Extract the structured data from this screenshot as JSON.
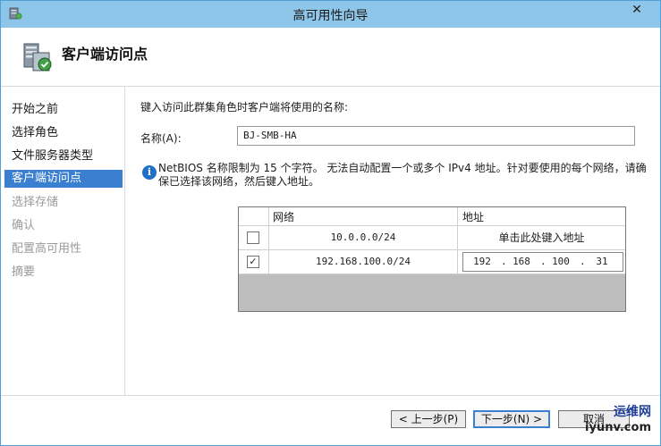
{
  "window": {
    "title": "高可用性向导",
    "close_label": "✕"
  },
  "header": {
    "title": "客户端访问点"
  },
  "sidebar": {
    "items": [
      {
        "label": "开始之前",
        "state": "normal"
      },
      {
        "label": "选择角色",
        "state": "normal"
      },
      {
        "label": "文件服务器类型",
        "state": "normal"
      },
      {
        "label": "客户端访问点",
        "state": "active"
      },
      {
        "label": "选择存储",
        "state": "disabled"
      },
      {
        "label": "确认",
        "state": "disabled"
      },
      {
        "label": "配置高可用性",
        "state": "disabled"
      },
      {
        "label": "摘要",
        "state": "disabled"
      }
    ]
  },
  "content": {
    "instruction": "键入访问此群集角色时客户端将使用的名称:",
    "name_label": "名称(A):",
    "name_value": "BJ-SMB-HA",
    "info_text": "NetBIOS 名称限制为 15 个字符。 无法自动配置一个或多个 IPv4 地址。针对要使用的每个网络，请确保已选择该网络，然后键入地址。",
    "grid": {
      "columns": [
        "网络",
        "地址"
      ],
      "rows": [
        {
          "checked": false,
          "network": "10.0.0.0/24",
          "address_prompt": "单击此处键入地址"
        },
        {
          "checked": true,
          "network": "192.168.100.0/24",
          "address": [
            "192",
            "168",
            "100",
            "31"
          ]
        }
      ]
    }
  },
  "footer": {
    "prev_label": "< 上一步(P)",
    "next_label": "下一步(N) >",
    "cancel_label": "取消"
  },
  "watermark": {
    "line1": "运维网",
    "line2": "iyunv.com"
  },
  "colors": {
    "titlebar": "#8ec6ea",
    "accent": "#3b7fd1",
    "info": "#1f6fc4"
  }
}
